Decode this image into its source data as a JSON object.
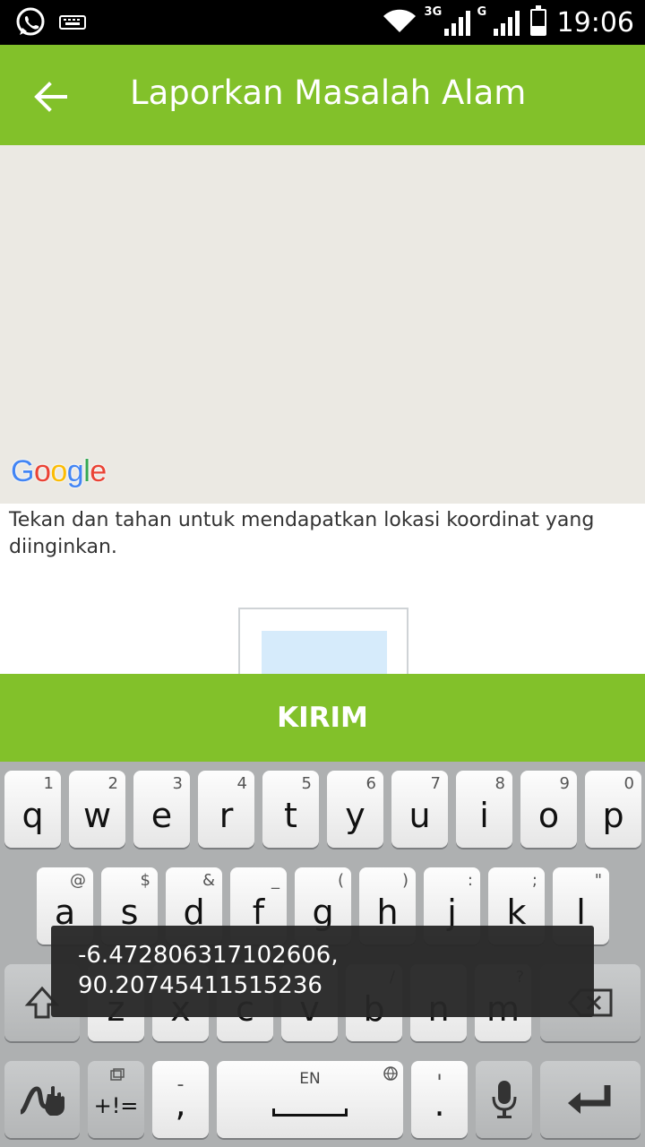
{
  "status_bar": {
    "time": "19:06",
    "network_labels": [
      "3G",
      "G"
    ],
    "battery_level": 0.35,
    "icons": [
      "whatsapp-icon",
      "keyboard-icon",
      "wifi-icon",
      "signal-3g-icon",
      "signal-g-icon",
      "battery-icon"
    ]
  },
  "app_bar": {
    "title": "Laporkan Masalah Alam",
    "back_icon": "arrow-left-icon",
    "color": "#82c12a"
  },
  "map": {
    "provider_logo": [
      "G",
      "o",
      "o",
      "g",
      "l",
      "e"
    ]
  },
  "hint": "Tekan dan tahan untuk mendapatkan lokasi koordinat yang diinginkan.",
  "submit_label": "KIRIM",
  "toast": {
    "line1": "-6.472806317102606,",
    "line2": "90.20745411515236"
  },
  "keyboard": {
    "row1": [
      {
        "key": "q",
        "sub": "1"
      },
      {
        "key": "w",
        "sub": "2"
      },
      {
        "key": "e",
        "sub": "3"
      },
      {
        "key": "r",
        "sub": "4"
      },
      {
        "key": "t",
        "sub": "5"
      },
      {
        "key": "y",
        "sub": "6"
      },
      {
        "key": "u",
        "sub": "7"
      },
      {
        "key": "i",
        "sub": "8"
      },
      {
        "key": "o",
        "sub": "9"
      },
      {
        "key": "p",
        "sub": "0"
      }
    ],
    "row2": [
      {
        "key": "a",
        "sub": "@"
      },
      {
        "key": "s",
        "sub": "$"
      },
      {
        "key": "d",
        "sub": "&"
      },
      {
        "key": "f",
        "sub": "_"
      },
      {
        "key": "g",
        "sub": "("
      },
      {
        "key": "h",
        "sub": ")"
      },
      {
        "key": "j",
        "sub": ":"
      },
      {
        "key": "k",
        "sub": ";"
      },
      {
        "key": "l",
        "sub": "\""
      }
    ],
    "row3": [
      {
        "key": "z",
        "sub": ""
      },
      {
        "key": "x",
        "sub": ""
      },
      {
        "key": "c",
        "sub": ""
      },
      {
        "key": "v",
        "sub": ""
      },
      {
        "key": "b",
        "sub": "/"
      },
      {
        "key": "n",
        "sub": ""
      },
      {
        "key": "m",
        "sub": "?"
      }
    ],
    "symbols_label": "+!=",
    "comma_label": ",",
    "comma_sub": "-",
    "space_label": "EN",
    "period_label": ".",
    "period_sub": "'"
  }
}
